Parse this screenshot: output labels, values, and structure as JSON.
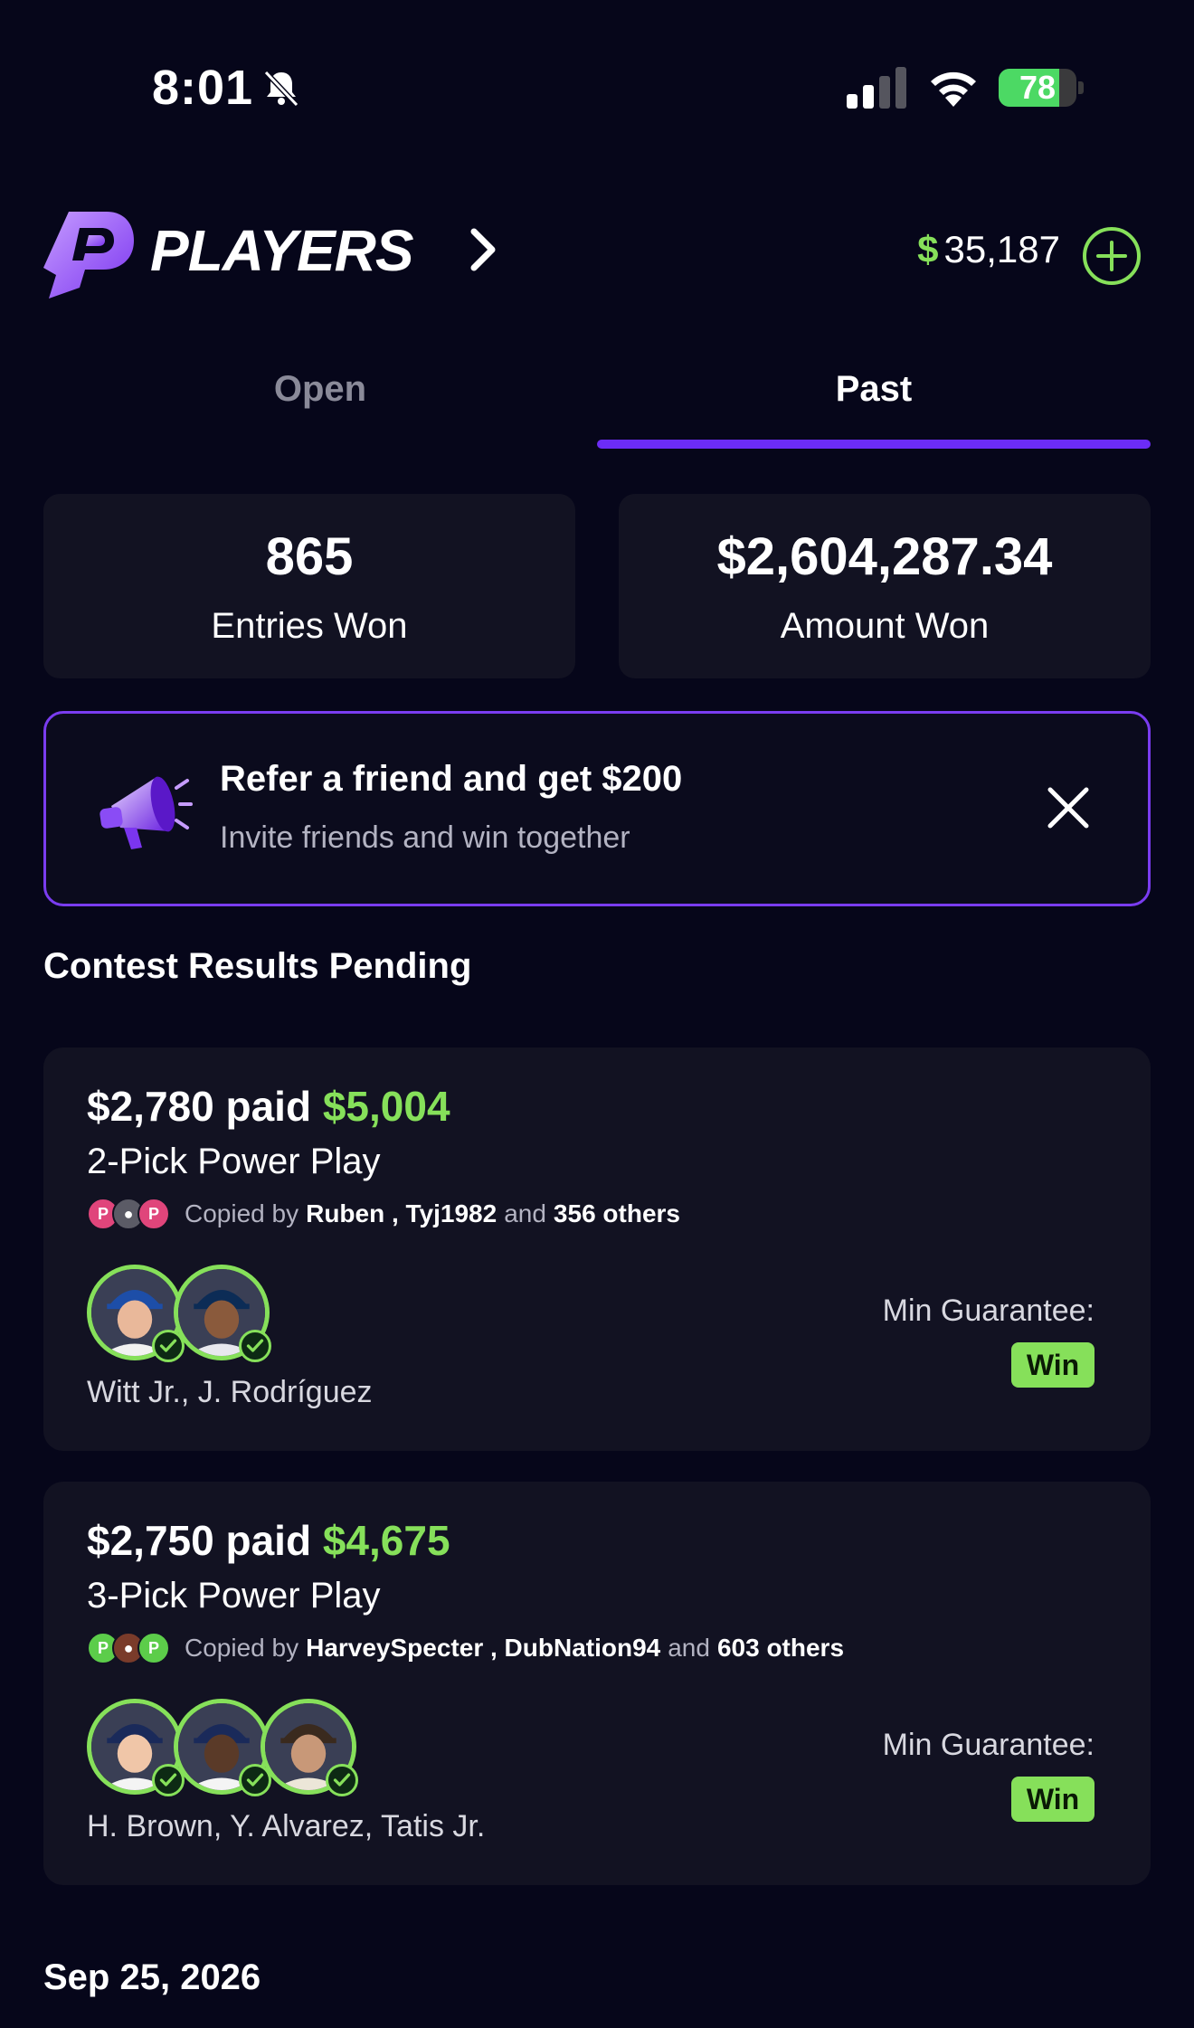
{
  "status_bar": {
    "time": "8:01",
    "battery": "78",
    "battery_level": 0.78
  },
  "header": {
    "brand": "PLAYERS",
    "balance": "35,187",
    "currency_symbol": "$"
  },
  "tabs": [
    {
      "label": "Open",
      "active": false
    },
    {
      "label": "Past",
      "active": true
    }
  ],
  "stats": {
    "entries_won": {
      "value": "865",
      "label": "Entries Won"
    },
    "amount_won": {
      "value": "$2,604,287.34",
      "label": "Amount Won"
    }
  },
  "referral": {
    "title": "Refer a friend and get $200",
    "subtitle": "Invite friends and win together"
  },
  "section_title": "Contest Results Pending",
  "contests": [
    {
      "paid": "$2,780 paid",
      "won": "$5,004",
      "type": "2-Pick Power Play",
      "copied_prefix": "Copied by",
      "copied_users": "Ruben , Tyj1982",
      "copied_and": "and",
      "copied_others": "356 others",
      "players": "Witt Jr., J. Rodríguez",
      "min_guarantee_label": "Min Guarantee:",
      "result": "Win"
    },
    {
      "paid": "$2,750 paid",
      "won": "$4,675",
      "type": "3-Pick Power Play",
      "copied_prefix": "Copied by",
      "copied_users": "HarveySpecter , DubNation94",
      "copied_and": "and",
      "copied_others": "603 others",
      "players": "H. Brown, Y. Alvarez, Tatis Jr.",
      "min_guarantee_label": "Min Guarantee:",
      "result": "Win"
    }
  ],
  "date_label": "Sep 25, 2026",
  "colors": {
    "accent_purple": "#6c2cf5",
    "accent_green": "#86e05a",
    "background": "#06061a",
    "card": "#121222"
  }
}
